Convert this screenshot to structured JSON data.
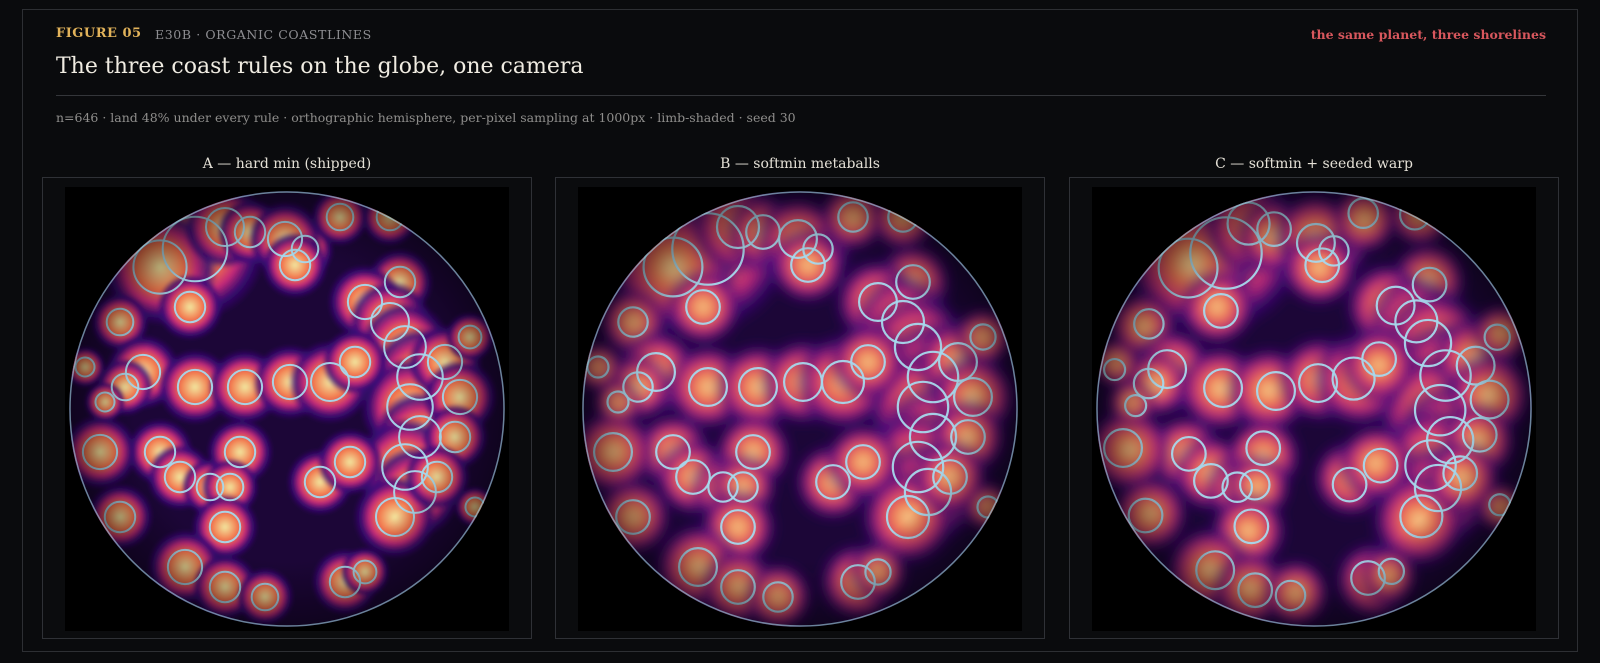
{
  "header": {
    "figure_label": "FIGURE 05",
    "code": "E30B · ORGANIC COASTLINES",
    "tagline": "the same planet, three shorelines",
    "title": "The three coast rules on the globe, one camera",
    "subtitle": "n=646 · land 48% under every rule · orthographic hemisphere, per-pixel sampling at 1000px · limb-shaded · seed 30"
  },
  "panels": [
    {
      "title": "A — hard min (shipped)",
      "style": "hard"
    },
    {
      "title": "B — softmin metaballs",
      "style": "soft"
    },
    {
      "title": "C — softmin + seeded warp",
      "style": "warp"
    }
  ],
  "colors": {
    "background": "#0a0b0d",
    "accent_gold": "#e2b35a",
    "accent_red": "#d8575d",
    "coastline": "#a6d8ec",
    "ocean": "#000000",
    "land_high": "#f2e9a0",
    "land_mid": "#f2744a",
    "land_low": "#c42a78",
    "deep": "#3b0a78"
  }
}
